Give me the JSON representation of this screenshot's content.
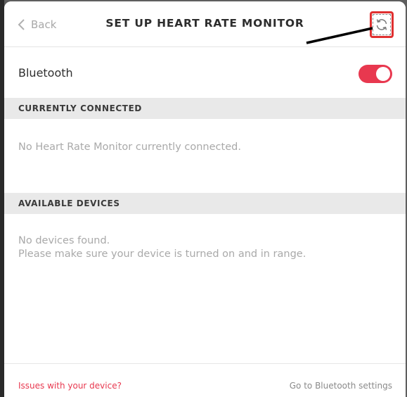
{
  "header": {
    "back_label": "Back",
    "title": "SET UP HEART RATE MONITOR",
    "refresh_icon": "refresh-icon"
  },
  "bluetooth": {
    "label": "Bluetooth",
    "enabled": true,
    "toggle_color": "#e8384f"
  },
  "sections": {
    "connected": {
      "title": "CURRENTLY CONNECTED",
      "message": "No Heart Rate Monitor currently connected."
    },
    "available": {
      "title": "AVAILABLE DEVICES",
      "message_line1": "No devices found.",
      "message_line2": "Please make sure your device is turned on and in range."
    }
  },
  "footer": {
    "issues_link": "Issues with your device?",
    "settings_link": "Go to Bluetooth settings"
  },
  "colors": {
    "accent": "#e8384f",
    "annotation_box": "#e03030",
    "annotation_arrow": "#000000"
  }
}
